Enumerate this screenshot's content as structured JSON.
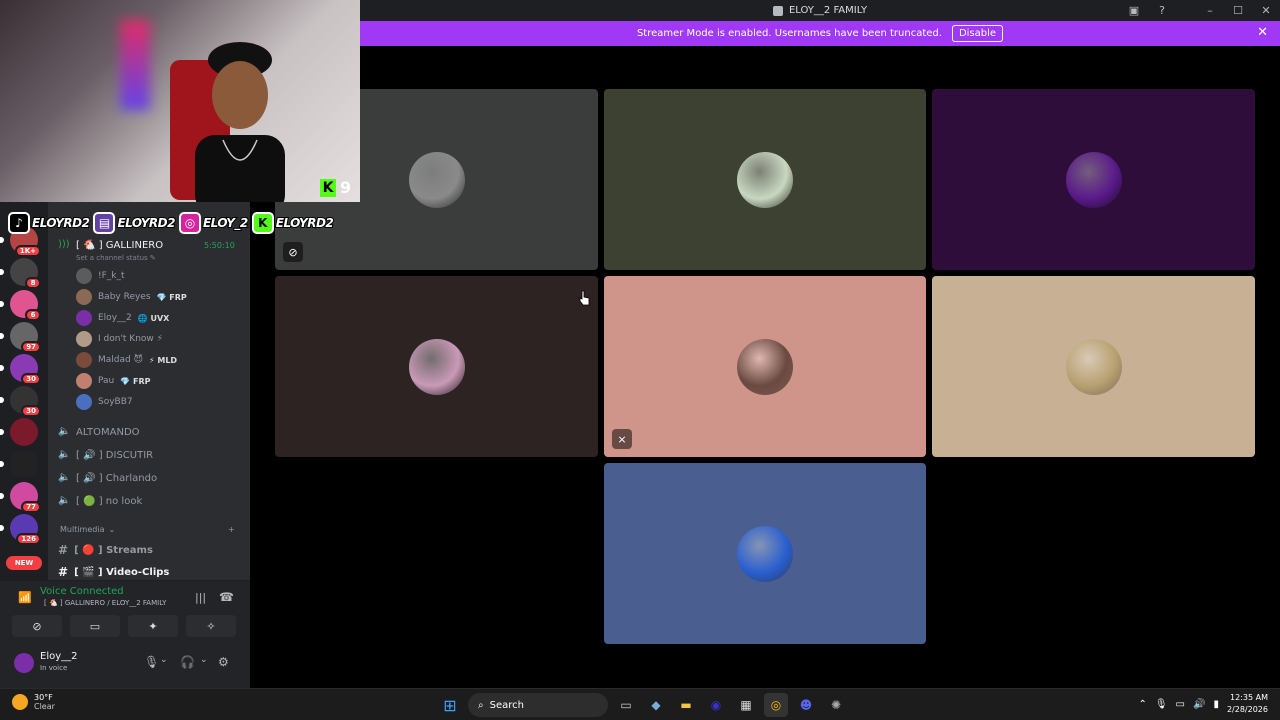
{
  "window": {
    "title": "ELOY__2 FAMILY"
  },
  "banner": {
    "text": "Streamer Mode is enabled. Usernames have been truncated.",
    "disable_label": "Disable"
  },
  "channels": {
    "active_voice": {
      "name": "[ 🐔 ] GALLINERO",
      "timer": "5:50:10",
      "status_hint": "Set a channel status ✎"
    },
    "voice_users": [
      {
        "name": "!F_k_t",
        "color": "#5c5c5c",
        "tag": ""
      },
      {
        "name": "Baby Reyes",
        "color": "#8a6a55",
        "tag": "💎 FRP"
      },
      {
        "name": "Eloy__2",
        "color": "#7a2ea8",
        "tag": "🌐 UVX"
      },
      {
        "name": "I don't Know ⚡",
        "color": "#b09a8a",
        "tag": ""
      },
      {
        "name": "Maldad 😈",
        "color": "#7a4a3a",
        "tag": "⚡ MLD"
      },
      {
        "name": "Pau",
        "color": "#c08070",
        "tag": "💎 FRP"
      },
      {
        "name": "SoyBB7",
        "color": "#4a6fbf",
        "tag": ""
      }
    ],
    "other_voice": [
      {
        "name": "ALTOMANDO",
        "emoji_color": "#23a559"
      },
      {
        "name": "[ 🔊 ] DISCUTIR",
        "emoji_color": ""
      },
      {
        "name": "[ 🔊 ] Charlando",
        "emoji_color": ""
      },
      {
        "name": "[ 🟢 ] no look",
        "emoji_color": ""
      }
    ],
    "category": "Multimedia",
    "text_channels": [
      {
        "name": "[ 🔴 ] Streams"
      },
      {
        "name": "[ 🎬 ] Video-Clips"
      }
    ]
  },
  "servers": [
    {
      "color": "#b34545",
      "count": "1K+"
    },
    {
      "color": "#444444",
      "count": "8"
    },
    {
      "color": "#e05590",
      "count": "6"
    },
    {
      "color": "#666666",
      "count": "97"
    },
    {
      "color": "#8a3ab3",
      "count": "30"
    },
    {
      "color": "#333333",
      "count": "30"
    },
    {
      "color": "#7a1a2a",
      "count": ""
    },
    {
      "color": "#222222",
      "count": ""
    },
    {
      "color": "#d04aa0",
      "count": "77"
    },
    {
      "color": "#5a3ab3",
      "count": "126"
    }
  ],
  "new_label": "NEW",
  "voice_panel": {
    "connected_label": "Voice Connected",
    "location": "[ 🐔 ] GALLINERO / ELOY__2 FAMILY",
    "username": "Eloy__2",
    "status": "In voice"
  },
  "overlay": {
    "socials": [
      {
        "platform": "tiktok",
        "handle": "ELOYRD2",
        "color": "#000000"
      },
      {
        "platform": "twitch",
        "handle": "ELOYRD2",
        "color": "#6441a5"
      },
      {
        "platform": "instagram",
        "handle": "ELOY_2",
        "color": "#d6249f"
      },
      {
        "platform": "kick",
        "handle": "ELOYRD2",
        "color": "#53fc18"
      }
    ],
    "kick_viewers": "9"
  },
  "tiles": [
    {
      "bg": "#3a3d3b",
      "avatar": "#8a8a8a",
      "icon": "camera-off-icon"
    },
    {
      "bg": "#3c4132",
      "avatar": "#c8d8c0",
      "icon": ""
    },
    {
      "bg": "#2e0d3a",
      "avatar": "#5a1a8a",
      "icon": ""
    },
    {
      "bg": "#2d2323",
      "avatar": "#c99ab8",
      "icon": ""
    },
    {
      "bg": "#d0958a",
      "avatar": "#6a4a40",
      "icon": "mic-off-icon"
    },
    {
      "bg": "#c7b093",
      "avatar": "#b8a070",
      "icon": ""
    },
    {
      "bg": "#4a5f8f",
      "avatar": "#2a5fd0",
      "icon": ""
    }
  ],
  "taskbar": {
    "temp": "30°F",
    "condition": "Clear",
    "search_label": "Search",
    "time": "12:35 AM",
    "date": "2/28/2026"
  }
}
